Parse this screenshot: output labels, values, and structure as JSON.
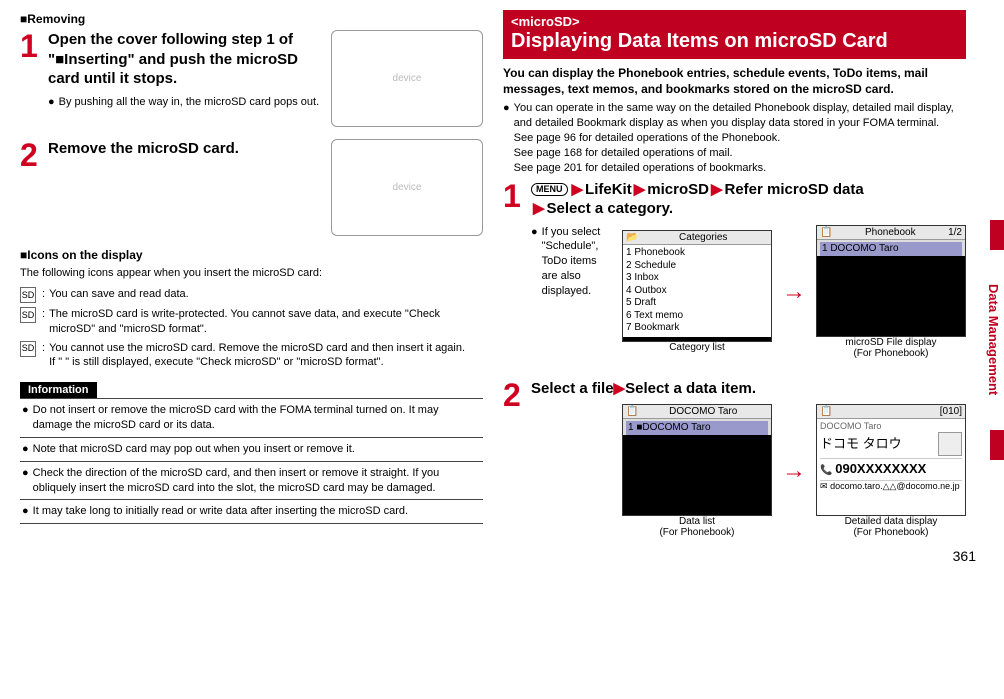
{
  "left": {
    "removing_heading": "■Removing",
    "step1_title": "Open the cover following step 1 of \"■Inserting\" and push the microSD card until it stops.",
    "step1_bullet": "By pushing all the way in, the microSD card pops out.",
    "step2_title": "Remove the microSD card.",
    "icons_heading": "■Icons on the display",
    "icons_intro": "The following icons appear when you insert the microSD card:",
    "icon1": "You can save and read data.",
    "icon2": "The microSD card is write-protected. You cannot save data, and execute \"Check microSD\" and \"microSD format\".",
    "icon3a": "You cannot use the microSD card. Remove the microSD card and then insert it again.",
    "icon3b": "If \"   \" is still displayed, execute \"Check microSD\" or \"microSD format\".",
    "info_heading": "Information",
    "info1": "Do not insert or remove the microSD card with the FOMA terminal turned on. It may damage the microSD card or its data.",
    "info2": "Note that microSD card may pop out when you insert or remove it.",
    "info3": "Check the direction of the microSD card, and then insert or remove it straight. If you obliquely insert the microSD card into the slot, the microSD card may be damaged.",
    "info4": "It may take long to initially read or write data after inserting the microSD card."
  },
  "right": {
    "band_sub": "<microSD>",
    "band_main": "Displaying Data Items on microSD Card",
    "lead": "You can display the Phonebook entries, schedule events, ToDo items, mail messages, text memos, and bookmarks stored on the microSD card.",
    "note1": "You can operate in the same way on the detailed Phonebook display, detailed mail display, and detailed Bookmark display as when you display data stored in your FOMA terminal.",
    "note2": "See page 96 for detailed operations of the Phonebook.",
    "note3": "See page 168 for detailed operations of mail.",
    "note4": "See page 201 for detailed operations of bookmarks.",
    "menu_label": "MENU",
    "nav_lifekit": "LifeKit",
    "nav_microsd": "microSD",
    "nav_refer": "Refer microSD data",
    "nav_select_cat": "Select a category.",
    "step1_bullet": "If you select \"Schedule\", ToDo items are also displayed.",
    "step2_title": "Select a file▶Select a data item.",
    "screens": {
      "cat_title": "Categories",
      "cat_items": [
        "1 Phonebook",
        "2 Schedule",
        "3 Inbox",
        "4 Outbox",
        "5 Draft",
        "6 Text memo",
        "7 Bookmark"
      ],
      "cat_caption": "Category list",
      "file_title_left": "Phonebook",
      "file_title_right": "1/2",
      "file_item": "1 DOCOMO Taro",
      "file_caption1": "microSD File display",
      "file_caption2": "(For Phonebook)",
      "data_title": "DOCOMO Taro",
      "data_item": "1 ■DOCOMO Taro",
      "data_caption1": "Data list",
      "data_caption2": "(For Phonebook)",
      "detail_badge": "[010]",
      "detail_name": "DOCOMO Taro",
      "detail_kana": "ドコモ タロウ",
      "detail_phone": "090XXXXXXXX",
      "detail_mail": "docomo.taro.△△@docomo.ne.jp",
      "detail_caption1": "Detailed data display",
      "detail_caption2": "(For Phonebook)"
    }
  },
  "side_tab": "Data Management",
  "page_number": "361"
}
